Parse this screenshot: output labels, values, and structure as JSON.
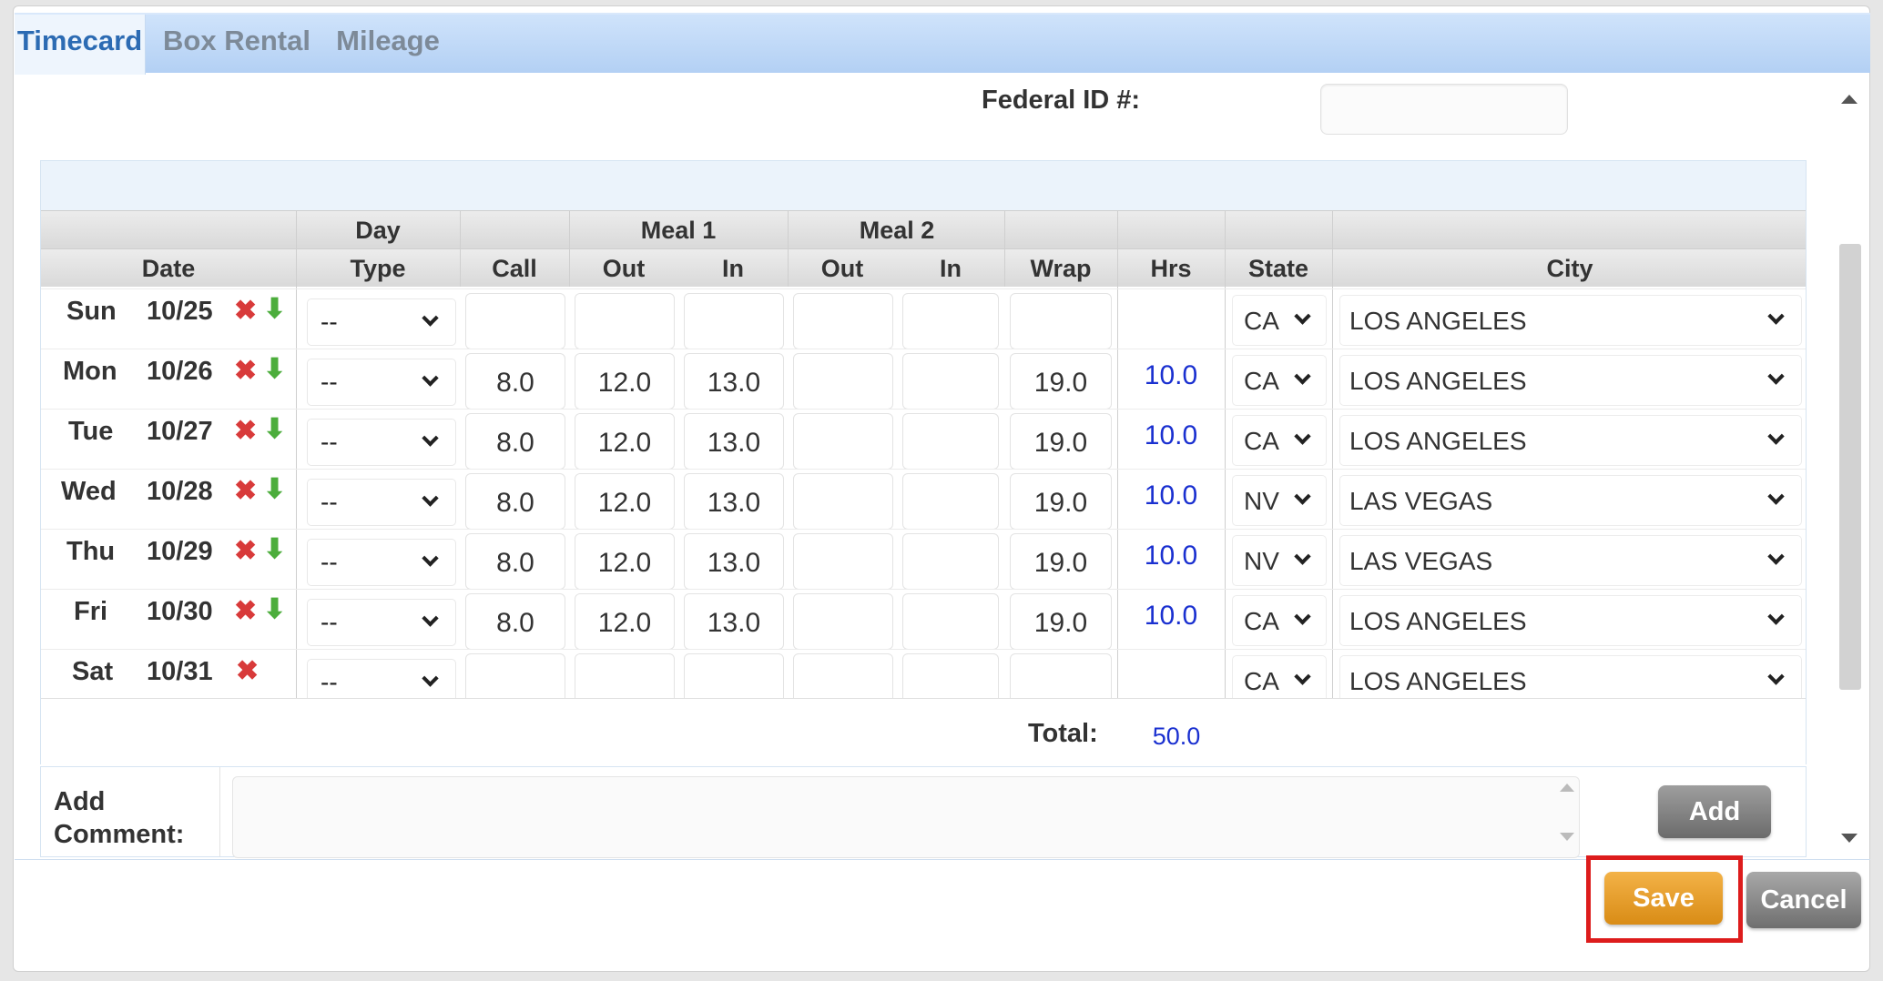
{
  "tabs": [
    {
      "label": "Timecard",
      "active": true
    },
    {
      "label": "Box Rental",
      "active": false
    },
    {
      "label": "Mileage",
      "active": false
    }
  ],
  "federal_id": {
    "label": "Federal ID #:",
    "value": ""
  },
  "table": {
    "header_top": {
      "day": "Day",
      "meal1": "Meal 1",
      "meal2": "Meal 2"
    },
    "header_bottom": {
      "date": "Date",
      "type": "Type",
      "call": "Call",
      "meal1_out": "Out",
      "meal1_in": "In",
      "meal2_out": "Out",
      "meal2_in": "In",
      "wrap": "Wrap",
      "hrs": "Hrs",
      "state": "State",
      "city": "City"
    },
    "rows": [
      {
        "day": "Sun",
        "date": "10/25",
        "type": "--",
        "call": "",
        "m1out": "",
        "m1in": "",
        "m2out": "",
        "m2in": "",
        "wrap": "",
        "hrs": "",
        "state": "CA",
        "city": "LOS ANGELES",
        "copy_down": true
      },
      {
        "day": "Mon",
        "date": "10/26",
        "type": "--",
        "call": "8.0",
        "m1out": "12.0",
        "m1in": "13.0",
        "m2out": "",
        "m2in": "",
        "wrap": "19.0",
        "hrs": "10.0",
        "state": "CA",
        "city": "LOS ANGELES",
        "copy_down": true
      },
      {
        "day": "Tue",
        "date": "10/27",
        "type": "--",
        "call": "8.0",
        "m1out": "12.0",
        "m1in": "13.0",
        "m2out": "",
        "m2in": "",
        "wrap": "19.0",
        "hrs": "10.0",
        "state": "CA",
        "city": "LOS ANGELES",
        "copy_down": true
      },
      {
        "day": "Wed",
        "date": "10/28",
        "type": "--",
        "call": "8.0",
        "m1out": "12.0",
        "m1in": "13.0",
        "m2out": "",
        "m2in": "",
        "wrap": "19.0",
        "hrs": "10.0",
        "state": "NV",
        "city": "LAS VEGAS",
        "copy_down": true
      },
      {
        "day": "Thu",
        "date": "10/29",
        "type": "--",
        "call": "8.0",
        "m1out": "12.0",
        "m1in": "13.0",
        "m2out": "",
        "m2in": "",
        "wrap": "19.0",
        "hrs": "10.0",
        "state": "NV",
        "city": "LAS VEGAS",
        "copy_down": true
      },
      {
        "day": "Fri",
        "date": "10/30",
        "type": "--",
        "call": "8.0",
        "m1out": "12.0",
        "m1in": "13.0",
        "m2out": "",
        "m2in": "",
        "wrap": "19.0",
        "hrs": "10.0",
        "state": "CA",
        "city": "LOS ANGELES",
        "copy_down": true
      },
      {
        "day": "Sat",
        "date": "10/31",
        "type": "--",
        "call": "",
        "m1out": "",
        "m1in": "",
        "m2out": "",
        "m2in": "",
        "wrap": "",
        "hrs": "",
        "state": "CA",
        "city": "LOS ANGELES",
        "copy_down": false
      }
    ],
    "total_label": "Total:",
    "total_value": "50.0"
  },
  "comment": {
    "label_line1": "Add",
    "label_line2": "Comment:",
    "value": "",
    "add_button": "Add"
  },
  "actions": {
    "save": "Save",
    "cancel": "Cancel"
  },
  "icons": {
    "delete": "delete-x-icon",
    "copy_down": "arrow-down-icon"
  },
  "colors": {
    "hours_blue": "#1a30d0",
    "save_orange": "#e39a1f",
    "highlight_red": "#dd1c1c",
    "tab_active": "#2c6bb3"
  }
}
